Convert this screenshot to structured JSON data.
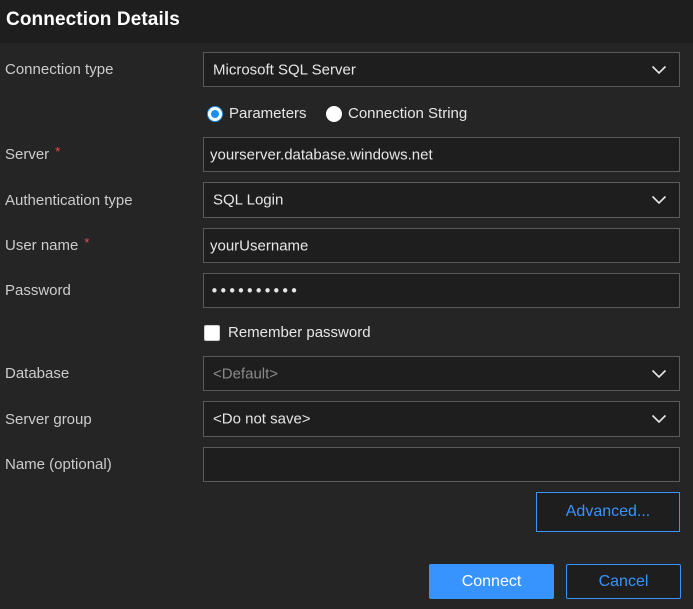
{
  "header": {
    "title": "Connection Details"
  },
  "connection_type": {
    "label": "Connection type",
    "value": "Microsoft SQL Server",
    "icon": "chevron-down-icon"
  },
  "mode": {
    "options": [
      {
        "label": "Parameters",
        "checked": true
      },
      {
        "label": "Connection String",
        "checked": false
      }
    ]
  },
  "server": {
    "label": "Server",
    "required_mark": "*",
    "value": "yourserver.database.windows.net"
  },
  "auth_type": {
    "label": "Authentication type",
    "value": "SQL Login",
    "icon": "chevron-down-icon"
  },
  "user_name": {
    "label": "User name",
    "required_mark": "*",
    "value": "yourUsername"
  },
  "password": {
    "label": "Password",
    "value": "••••••••••"
  },
  "remember_password": {
    "label": "Remember password",
    "checked": false
  },
  "database": {
    "label": "Database",
    "value": "<Default>",
    "icon": "chevron-down-icon"
  },
  "server_group": {
    "label": "Server group",
    "value": "<Do not save>",
    "icon": "chevron-down-icon"
  },
  "name_optional": {
    "label": "Name (optional)",
    "value": ""
  },
  "buttons": {
    "advanced": "Advanced...",
    "connect": "Connect",
    "cancel": "Cancel"
  },
  "colors": {
    "accent": "#3794ff",
    "required": "#f14c4c",
    "background": "#252526",
    "header_background": "#1e1e1e",
    "field_background": "#1e1e1e"
  }
}
